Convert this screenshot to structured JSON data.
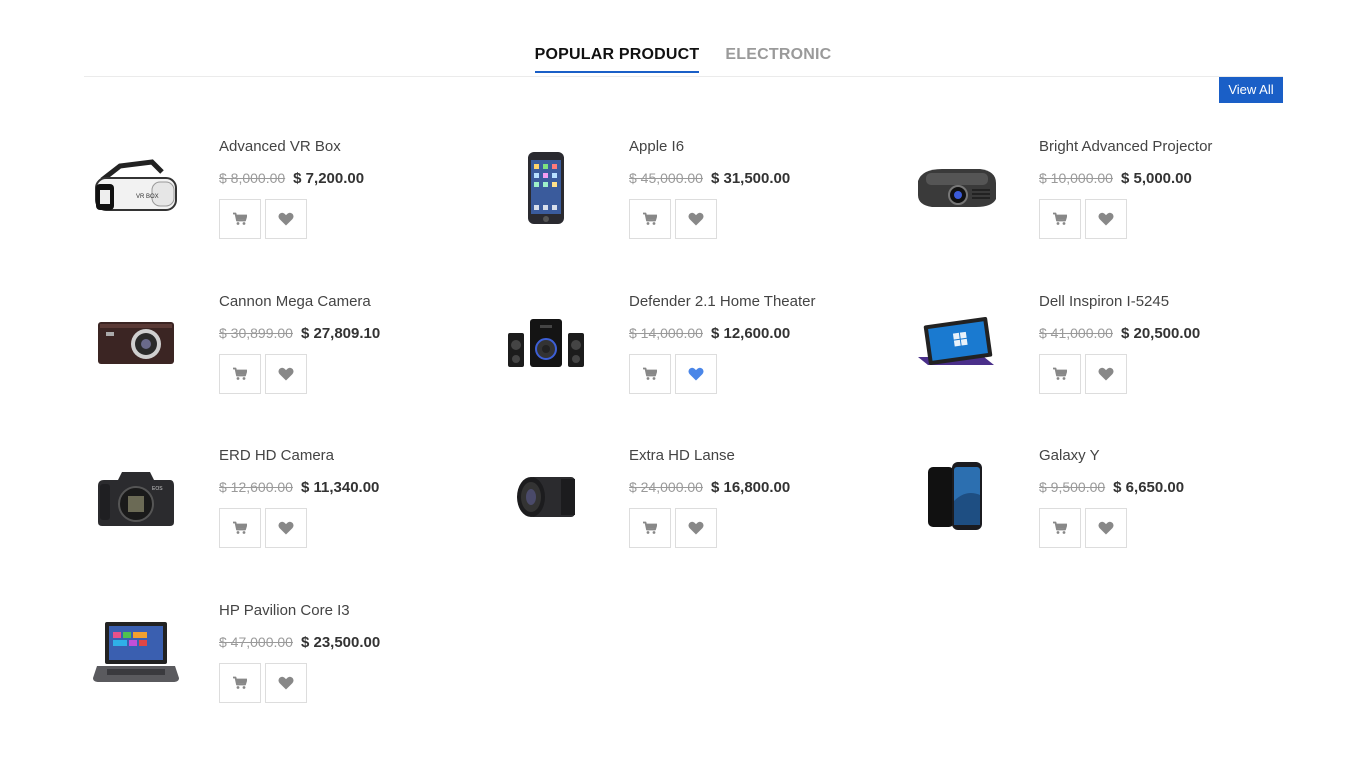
{
  "tabs": [
    {
      "label": "POPULAR PRODUCT",
      "active": true
    },
    {
      "label": "ELECTRONIC",
      "active": false
    }
  ],
  "view_all_label": "View All",
  "colors": {
    "accent": "#1a5fc7",
    "icon": "#888888",
    "wishlist_active": "#4a86e8"
  },
  "products": [
    {
      "name": "Advanced VR Box",
      "old_price": "$ 8,000.00",
      "price": "$ 7,200.00",
      "image": "vr-headset-image",
      "wishlisted": false
    },
    {
      "name": "Apple I6",
      "old_price": "$ 45,000.00",
      "price": "$ 31,500.00",
      "image": "smartphone-image",
      "wishlisted": false
    },
    {
      "name": "Bright Advanced Projector",
      "old_price": "$ 10,000.00",
      "price": "$ 5,000.00",
      "image": "projector-image",
      "wishlisted": false
    },
    {
      "name": "Cannon Mega Camera",
      "old_price": "$ 30,899.00",
      "price": "$ 27,809.10",
      "image": "compact-camera-image",
      "wishlisted": false
    },
    {
      "name": "Defender 2.1 Home Theater",
      "old_price": "$ 14,000.00",
      "price": "$ 12,600.00",
      "image": "speakers-image",
      "wishlisted": true
    },
    {
      "name": "Dell Inspiron I-5245",
      "old_price": "$ 41,000.00",
      "price": "$ 20,500.00",
      "image": "tablet-laptop-image",
      "wishlisted": false
    },
    {
      "name": "ERD HD Camera",
      "old_price": "$ 12,600.00",
      "price": "$ 11,340.00",
      "image": "dslr-camera-image",
      "wishlisted": false
    },
    {
      "name": "Extra HD Lanse",
      "old_price": "$ 24,000.00",
      "price": "$ 16,800.00",
      "image": "camera-lens-image",
      "wishlisted": false
    },
    {
      "name": "Galaxy Y",
      "old_price": "$ 9,500.00",
      "price": "$ 6,650.00",
      "image": "galaxy-phone-image",
      "wishlisted": false
    },
    {
      "name": "HP Pavilion Core I3",
      "old_price": "$ 47,000.00",
      "price": "$ 23,500.00",
      "image": "laptop-image",
      "wishlisted": false
    }
  ]
}
